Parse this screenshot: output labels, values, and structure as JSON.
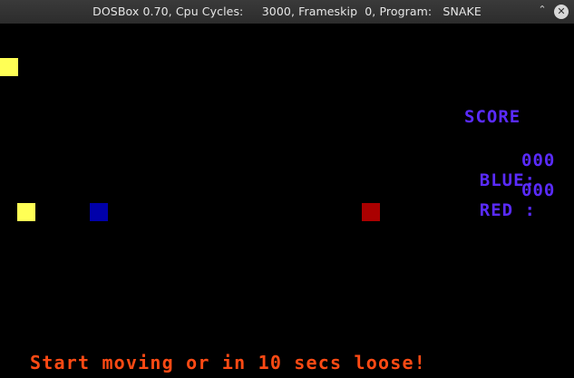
{
  "window": {
    "title": "DOSBox 0.70, Cpu Cycles:     3000, Frameskip  0, Program:   SNAKE",
    "min_icon": "chevron-up-icon",
    "close_icon": "close-icon",
    "min_glyph": "⌃",
    "close_glyph": "✕"
  },
  "game": {
    "colors": {
      "yellow": "#ffff55",
      "blue": "#0000aa",
      "red": "#aa0000",
      "score_text": "#5a2bff",
      "footer_text": "#ff4a14"
    },
    "score_title": "SCORE",
    "blue_label": "BLUE:",
    "blue_score": "000",
    "red_label": "RED :",
    "red_score": "000",
    "footer": "Start moving or in 10 secs loose!"
  }
}
